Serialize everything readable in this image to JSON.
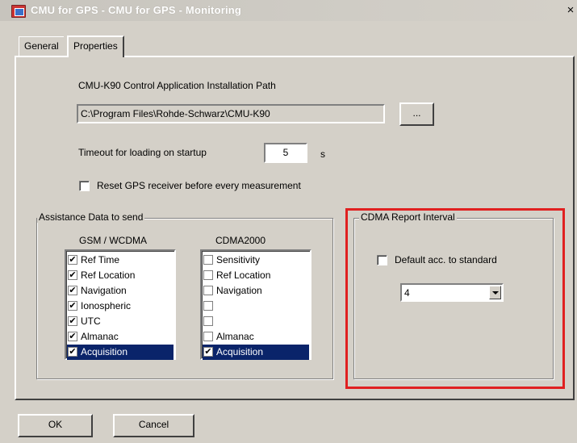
{
  "window": {
    "title": "CMU for GPS - CMU for GPS - Monitoring",
    "close_label": "×"
  },
  "tabs": [
    {
      "label": "General",
      "active": false
    },
    {
      "label": "Properties",
      "active": true
    }
  ],
  "install_path": {
    "label": "CMU-K90 Control Application Installation Path",
    "value": "C:\\Program Files\\Rohde-Schwarz\\CMU-K90",
    "browse_label": "..."
  },
  "timeout": {
    "label": "Timeout for loading on startup",
    "value": "5",
    "unit": "s"
  },
  "reset_gps": {
    "label": "Reset GPS receiver before every measurement",
    "checked": false
  },
  "assistance": {
    "title": "Assistance Data to send",
    "gsm": {
      "header": "GSM / WCDMA",
      "items": [
        {
          "label": "Ref Time",
          "checked": true,
          "selected": false
        },
        {
          "label": "Ref Location",
          "checked": true,
          "selected": false
        },
        {
          "label": "Navigation",
          "checked": true,
          "selected": false
        },
        {
          "label": "Ionospheric",
          "checked": true,
          "selected": false
        },
        {
          "label": "UTC",
          "checked": true,
          "selected": false
        },
        {
          "label": "Almanac",
          "checked": true,
          "selected": false
        },
        {
          "label": "Acquisition",
          "checked": true,
          "selected": true
        }
      ]
    },
    "cdma": {
      "header": "CDMA2000",
      "items": [
        {
          "label": "Sensitivity",
          "checked": false,
          "selected": false
        },
        {
          "label": "Ref Location",
          "checked": false,
          "selected": false
        },
        {
          "label": "Navigation",
          "checked": false,
          "selected": false
        },
        {
          "label": "",
          "checked": false,
          "selected": false
        },
        {
          "label": "",
          "checked": false,
          "selected": false
        },
        {
          "label": "Almanac",
          "checked": false,
          "selected": false
        },
        {
          "label": "Acquisition",
          "checked": true,
          "selected": true
        }
      ]
    }
  },
  "cdma_report": {
    "title": "CDMA Report Interval",
    "default_label": "Default acc. to standard",
    "default_checked": false,
    "interval_value": "4"
  },
  "buttons": {
    "ok_label": "OK",
    "cancel_label": "Cancel"
  },
  "colors": {
    "highlight": "#e02020",
    "selection": "#0a246a"
  }
}
